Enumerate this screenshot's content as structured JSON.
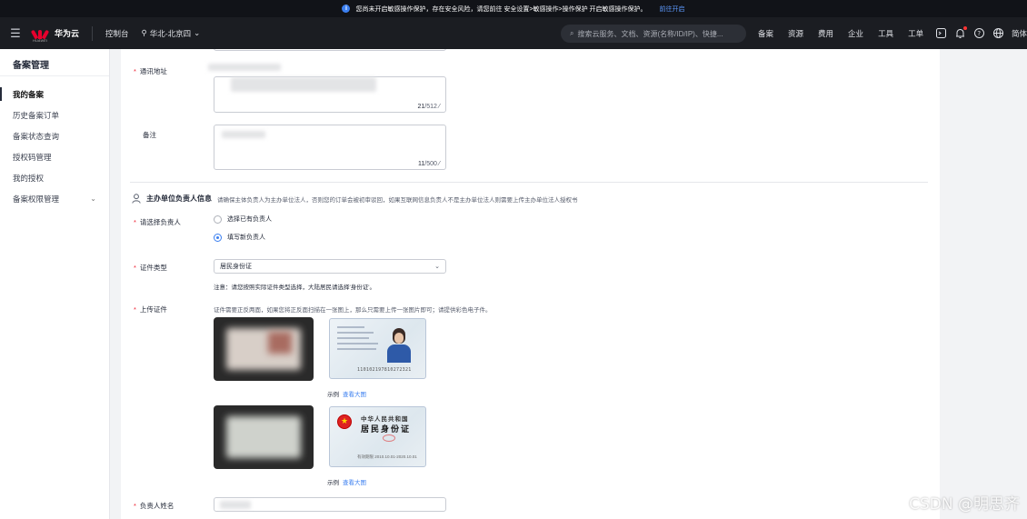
{
  "banner": {
    "text": "您尚未开启敏感操作保护，存在安全风险，请您前往 安全设置>敏感操作>操作保护 开启敏感操作保护。",
    "link": "前往开启"
  },
  "header": {
    "brand": "华为云",
    "brand_small": "HUAWEI",
    "console": "控制台",
    "region": "华北-北京四",
    "search_placeholder": "搜索云服务、文档、资源(名称/ID/IP)、快捷...",
    "nav": [
      "备案",
      "资源",
      "费用",
      "企业",
      "工具",
      "工单"
    ],
    "lang": "简体"
  },
  "sidebar": {
    "title": "备案管理",
    "items": [
      {
        "label": "我的备案"
      },
      {
        "label": "历史备案订单"
      },
      {
        "label": "备案状态查询"
      },
      {
        "label": "授权码管理"
      },
      {
        "label": "我的授权"
      },
      {
        "label": "备案权限管理"
      }
    ]
  },
  "form": {
    "address_label": "通讯地址",
    "address_count": "21",
    "address_max": "/512",
    "remark_label": "备注",
    "remark_count": "11",
    "remark_max": "/500",
    "section_title": "主办单位负责人信息",
    "section_desc": "请确保主体负责人为主办单位法人，否则您的订单会被初审驳回，如果互联网信息负责人不是主办单位法人则需要上传主办单位法人授权书",
    "choose_label": "请选择负责人",
    "radio_existing": "选择已有负责人",
    "radio_new": "填写新负责人",
    "cert_type_label": "证件类型",
    "cert_type_value": "居民身份证",
    "cert_note": "注意：请您按照实际证件类型选择，大陆居民请选择'身份证'。",
    "upload_label": "上传证件",
    "upload_tip": "证件需要正反两面，如果您将正反面扫描在一张图上，那么只需要上传一张图片即可；请提供彩色电子件。",
    "example_label": "示例",
    "view_large": "查看大图",
    "sample_front_id": "110102197810272321",
    "sample_back_title1": "中华人民共和国",
    "sample_back_title2": "居民身份证",
    "sample_back_valid": "有效期限 2010.10.01-2020.10.01",
    "name_label": "负责人姓名"
  },
  "watermark": "CSDN @明思齐"
}
